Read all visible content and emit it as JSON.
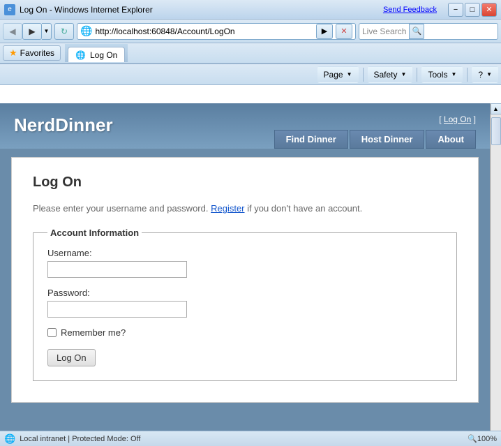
{
  "titlebar": {
    "title": "Log On - Windows Internet Explorer",
    "send_feedback": "Send Feedback",
    "min_btn": "−",
    "max_btn": "□",
    "close_btn": "✕"
  },
  "addressbar": {
    "url": "http://localhost:60848/Account/LogOn",
    "refresh_symbol": "↻",
    "stop_symbol": "✕",
    "back_symbol": "◀",
    "forward_symbol": "▶",
    "live_search_placeholder": "Live Search",
    "search_icon": "🔍"
  },
  "favoritesbar": {
    "favorites_label": "Favorites",
    "star_symbol": "★"
  },
  "tabs": [
    {
      "label": "Log On",
      "active": true
    }
  ],
  "toolbar": {
    "page_label": "Page",
    "safety_label": "Safety",
    "tools_label": "Tools",
    "help_symbol": "?"
  },
  "page": {
    "logo": "NerdDinner",
    "logon_link_prefix": "[ ",
    "logon_link_text": "Log On",
    "logon_link_suffix": " ]",
    "nav": {
      "find_dinner": "Find Dinner",
      "host_dinner": "Host Dinner",
      "about": "About"
    },
    "content": {
      "heading": "Log On",
      "description_prefix": "Please enter your username and password. ",
      "register_link": "Register",
      "description_suffix": " if you don't have an account.",
      "fieldset_legend": "Account Information",
      "username_label": "Username:",
      "password_label": "Password:",
      "remember_label": "Remember me?",
      "submit_label": "Log On"
    }
  },
  "statusbar": {
    "zone": "Local intranet | Protected Mode: Off",
    "zoom": "🔍100%",
    "globe_symbol": "🌐"
  }
}
